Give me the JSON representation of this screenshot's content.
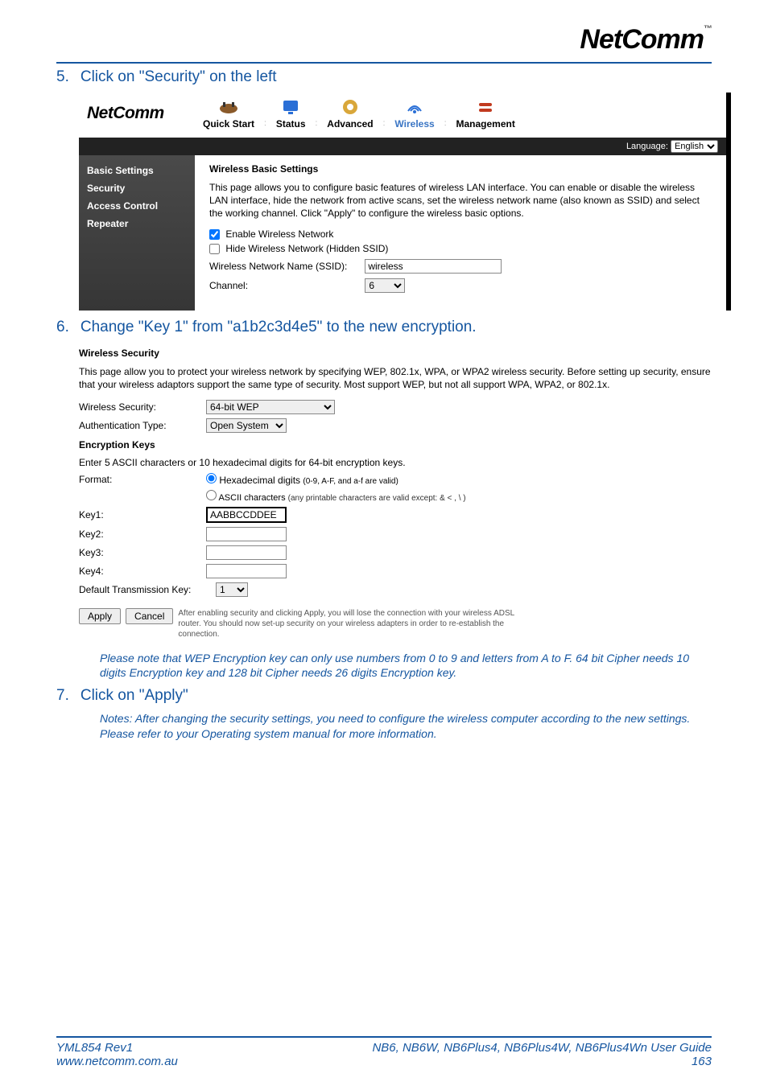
{
  "brand": {
    "name": "NetComm",
    "tm": "™"
  },
  "steps": {
    "s5": {
      "num": "5.",
      "text": "Click on \"Security\" on the left"
    },
    "s6": {
      "num": "6.",
      "text": "Change \"Key 1\" from \"a1b2c3d4e5\" to the new encryption."
    },
    "s7": {
      "num": "7.",
      "text": "Click on \"Apply\""
    }
  },
  "router": {
    "logo": "NetComm",
    "tabs": {
      "quick": "Quick Start",
      "status": "Status",
      "advanced": "Advanced",
      "wireless": "Wireless",
      "management": "Management"
    },
    "lang_label": "Language:",
    "lang_value": "English",
    "sidebar": {
      "basic": "Basic Settings",
      "security": "Security",
      "access": "Access Control",
      "repeater": "Repeater"
    },
    "basic": {
      "heading": "Wireless Basic Settings",
      "desc": "This page allows you to configure basic features of wireless LAN interface. You can enable or disable the wireless LAN interface, hide the network from active scans, set the wireless network name (also known as SSID) and select the working channel. Click \"Apply\" to configure the wireless basic options.",
      "enable": "Enable Wireless Network",
      "hide": "Hide Wireless Network (Hidden SSID)",
      "ssid_label": "Wireless Network Name (SSID):",
      "ssid_value": "wireless",
      "channel_label": "Channel:",
      "channel_value": "6"
    }
  },
  "security": {
    "heading": "Wireless Security",
    "desc": "This page allow you to protect your wireless network by specifying WEP, 802.1x, WPA, or WPA2 wireless security. Before setting up security, ensure that your wireless adaptors support the same type of security. Most support WEP, but not all support WPA, WPA2, or 802.1x.",
    "ws_label": "Wireless Security:",
    "ws_value": "64-bit WEP",
    "auth_label": "Authentication Type:",
    "auth_value": "Open System",
    "enc_heading": "Encryption Keys",
    "enc_note": "Enter 5 ASCII characters or 10 hexadecimal digits for 64-bit encryption keys.",
    "format_label": "Format:",
    "hex_label": "Hexadecimal digits",
    "hex_note": "(0-9, A-F, and a-f are valid)",
    "ascii_label": "ASCII characters",
    "ascii_note": "(any printable characters are valid except: & < , \\ )",
    "key1_label": "Key1:",
    "key1_value": "AABBCCDDEE",
    "key2_label": "Key2:",
    "key3_label": "Key3:",
    "key4_label": "Key4:",
    "deftx_label": "Default Transmission Key:",
    "deftx_value": "1",
    "apply": "Apply",
    "cancel": "Cancel",
    "apply_note": "After enabling security and clicking Apply, you will lose the connection with your wireless ADSL router. You should now set-up security on your wireless adapters in order to re-establish the connection."
  },
  "notes": {
    "wep_note": "Please note that WEP Encryption key can only use numbers from 0 to 9 and letters from A to F. 64 bit Cipher needs 10 digits Encryption key and 128 bit Cipher needs 26 digits Encryption key.",
    "after_apply": "Notes: After changing the security settings, you need to configure the wireless computer according to the new settings. Please refer to your Operating system manual for more information."
  },
  "footer": {
    "rev": "YML854 Rev1",
    "url": "www.netcomm.com.au",
    "models": "NB6, NB6W, NB6Plus4, NB6Plus4W, NB6Plus4Wn",
    "guide": " User Guide",
    "page": "163"
  }
}
